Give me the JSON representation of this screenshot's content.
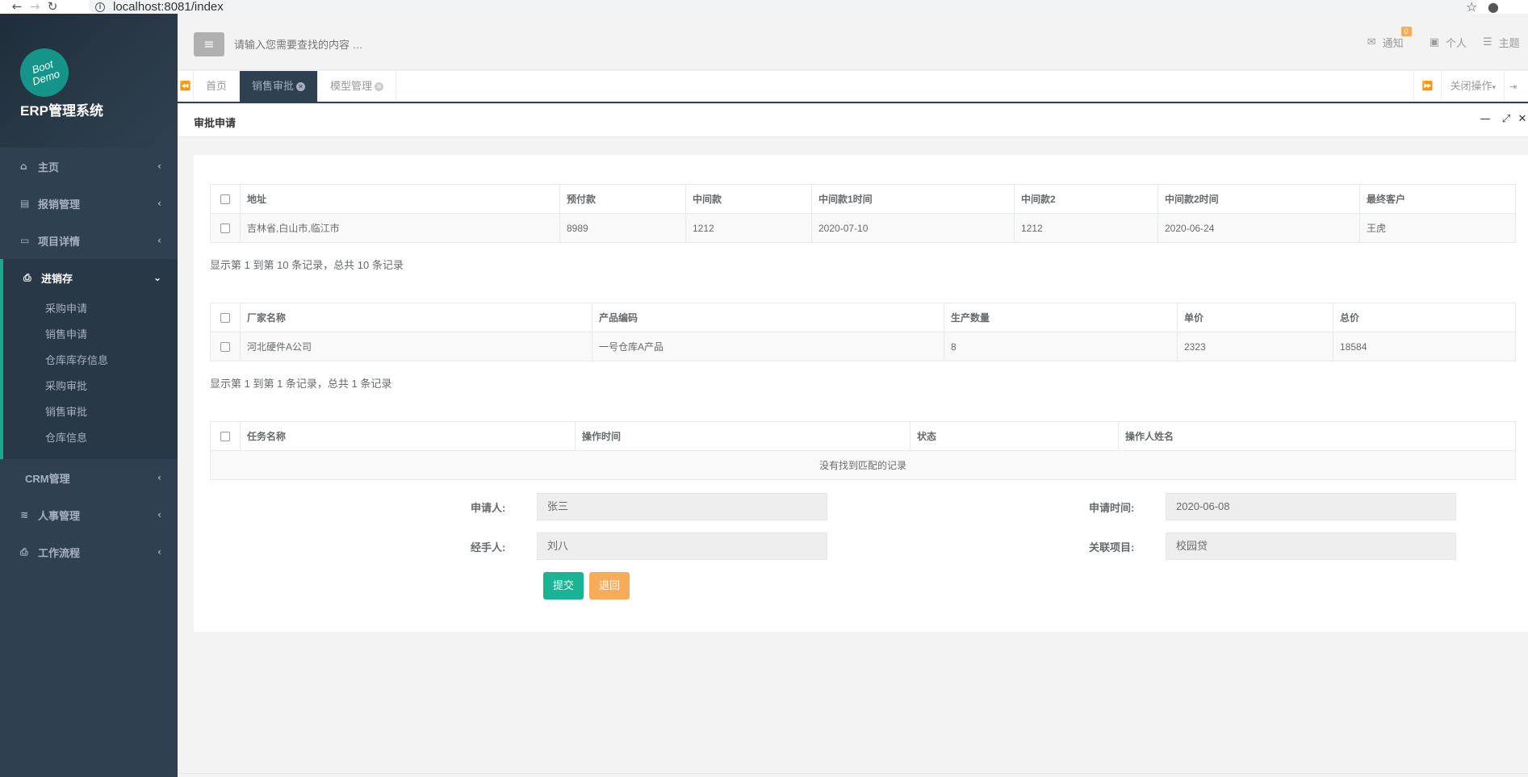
{
  "browser": {
    "url": "localhost:8081/index"
  },
  "sidebar": {
    "logo_line1": "Boot",
    "logo_line2": "Demo",
    "app_title": "ERP管理系统",
    "menu": [
      {
        "label": "主页"
      },
      {
        "label": "报销管理"
      },
      {
        "label": "项目详情"
      },
      {
        "label": "进销存"
      },
      {
        "label": "CRM管理"
      },
      {
        "label": "人事管理"
      },
      {
        "label": "工作流程"
      }
    ],
    "submenu": [
      "采购申请",
      "销售申请",
      "仓库库存信息",
      "采购审批",
      "销售审批",
      "仓库信息"
    ]
  },
  "header": {
    "search_placeholder": "请输入您需要查找的内容 …",
    "notify_label": "通知",
    "notify_count": "0",
    "personal_label": "个人",
    "theme_label": "主题"
  },
  "tabs": {
    "items": [
      "首页",
      "销售审批",
      "模型管理"
    ],
    "close_ops": "关闭操作",
    "logout": "退"
  },
  "panel": {
    "title": "审批申请"
  },
  "table1": {
    "headers": [
      "地址",
      "预付款",
      "中间款",
      "中间款1时间",
      "中间款2",
      "中间款2时间",
      "最终客户"
    ],
    "rows": [
      [
        "吉林省,白山市,临江市",
        "8989",
        "1212",
        "2020-07-10",
        "1212",
        "2020-06-24",
        "王虎"
      ]
    ],
    "pager": "显示第 1 到第 10 条记录，总共 10 条记录"
  },
  "table2": {
    "headers": [
      "厂家名称",
      "产品编码",
      "生产数量",
      "单价",
      "总价"
    ],
    "rows": [
      [
        "河北硬件A公司",
        "一号仓库A产品",
        "8",
        "2323",
        "18584"
      ]
    ],
    "pager": "显示第 1 到第 1 条记录，总共 1 条记录"
  },
  "table3": {
    "headers": [
      "任务名称",
      "操作时间",
      "状态",
      "操作人姓名"
    ],
    "empty": "没有找到匹配的记录"
  },
  "form": {
    "applicant_label": "申请人:",
    "applicant_value": "张三",
    "apply_time_label": "申请时间:",
    "apply_time_value": "2020-06-08",
    "handler_label": "经手人:",
    "handler_value": "刘八",
    "project_label": "关联项目:",
    "project_value": "校园贷",
    "submit": "提交",
    "back": "退回"
  }
}
